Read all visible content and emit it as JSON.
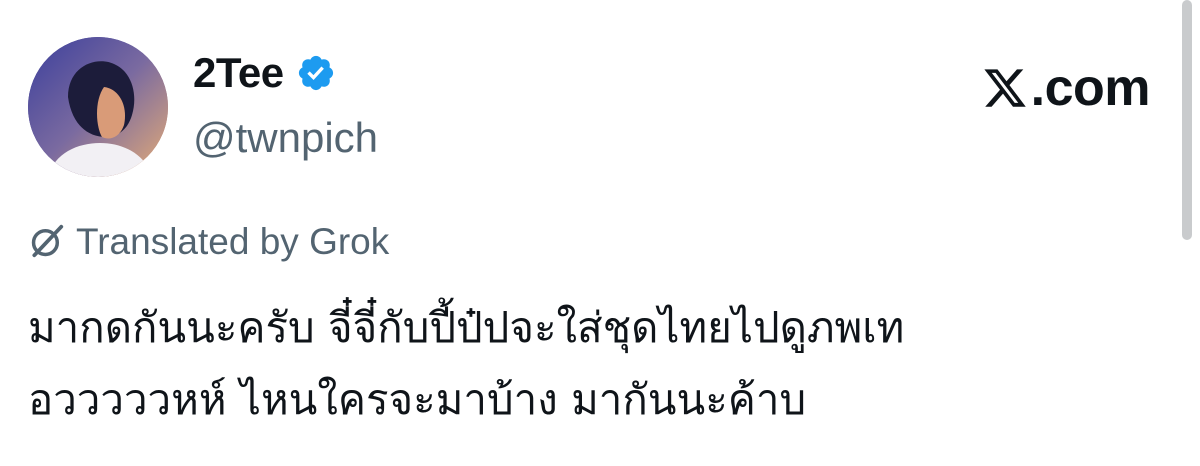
{
  "author": {
    "display_name": "2Tee",
    "handle": "@twnpich",
    "verified": true,
    "avatar_icon": "profile-photo"
  },
  "brand": {
    "text": ".com",
    "icon": "x-logo-icon"
  },
  "translation": {
    "label": "Translated by Grok",
    "icon": "grok-icon"
  },
  "tweet": {
    "lines": [
      "มากดกันนะครับ จี๋จี๋กับปี้ป๋ปจะใส่ชุดไทยไปดูภพเท",
      "อวววววหห์ ไหนใครจะมาบ้าง มากันนะค้าบ"
    ]
  },
  "colors": {
    "text": "#0f1419",
    "secondary": "#536471",
    "verified": "#1d9bf0"
  }
}
